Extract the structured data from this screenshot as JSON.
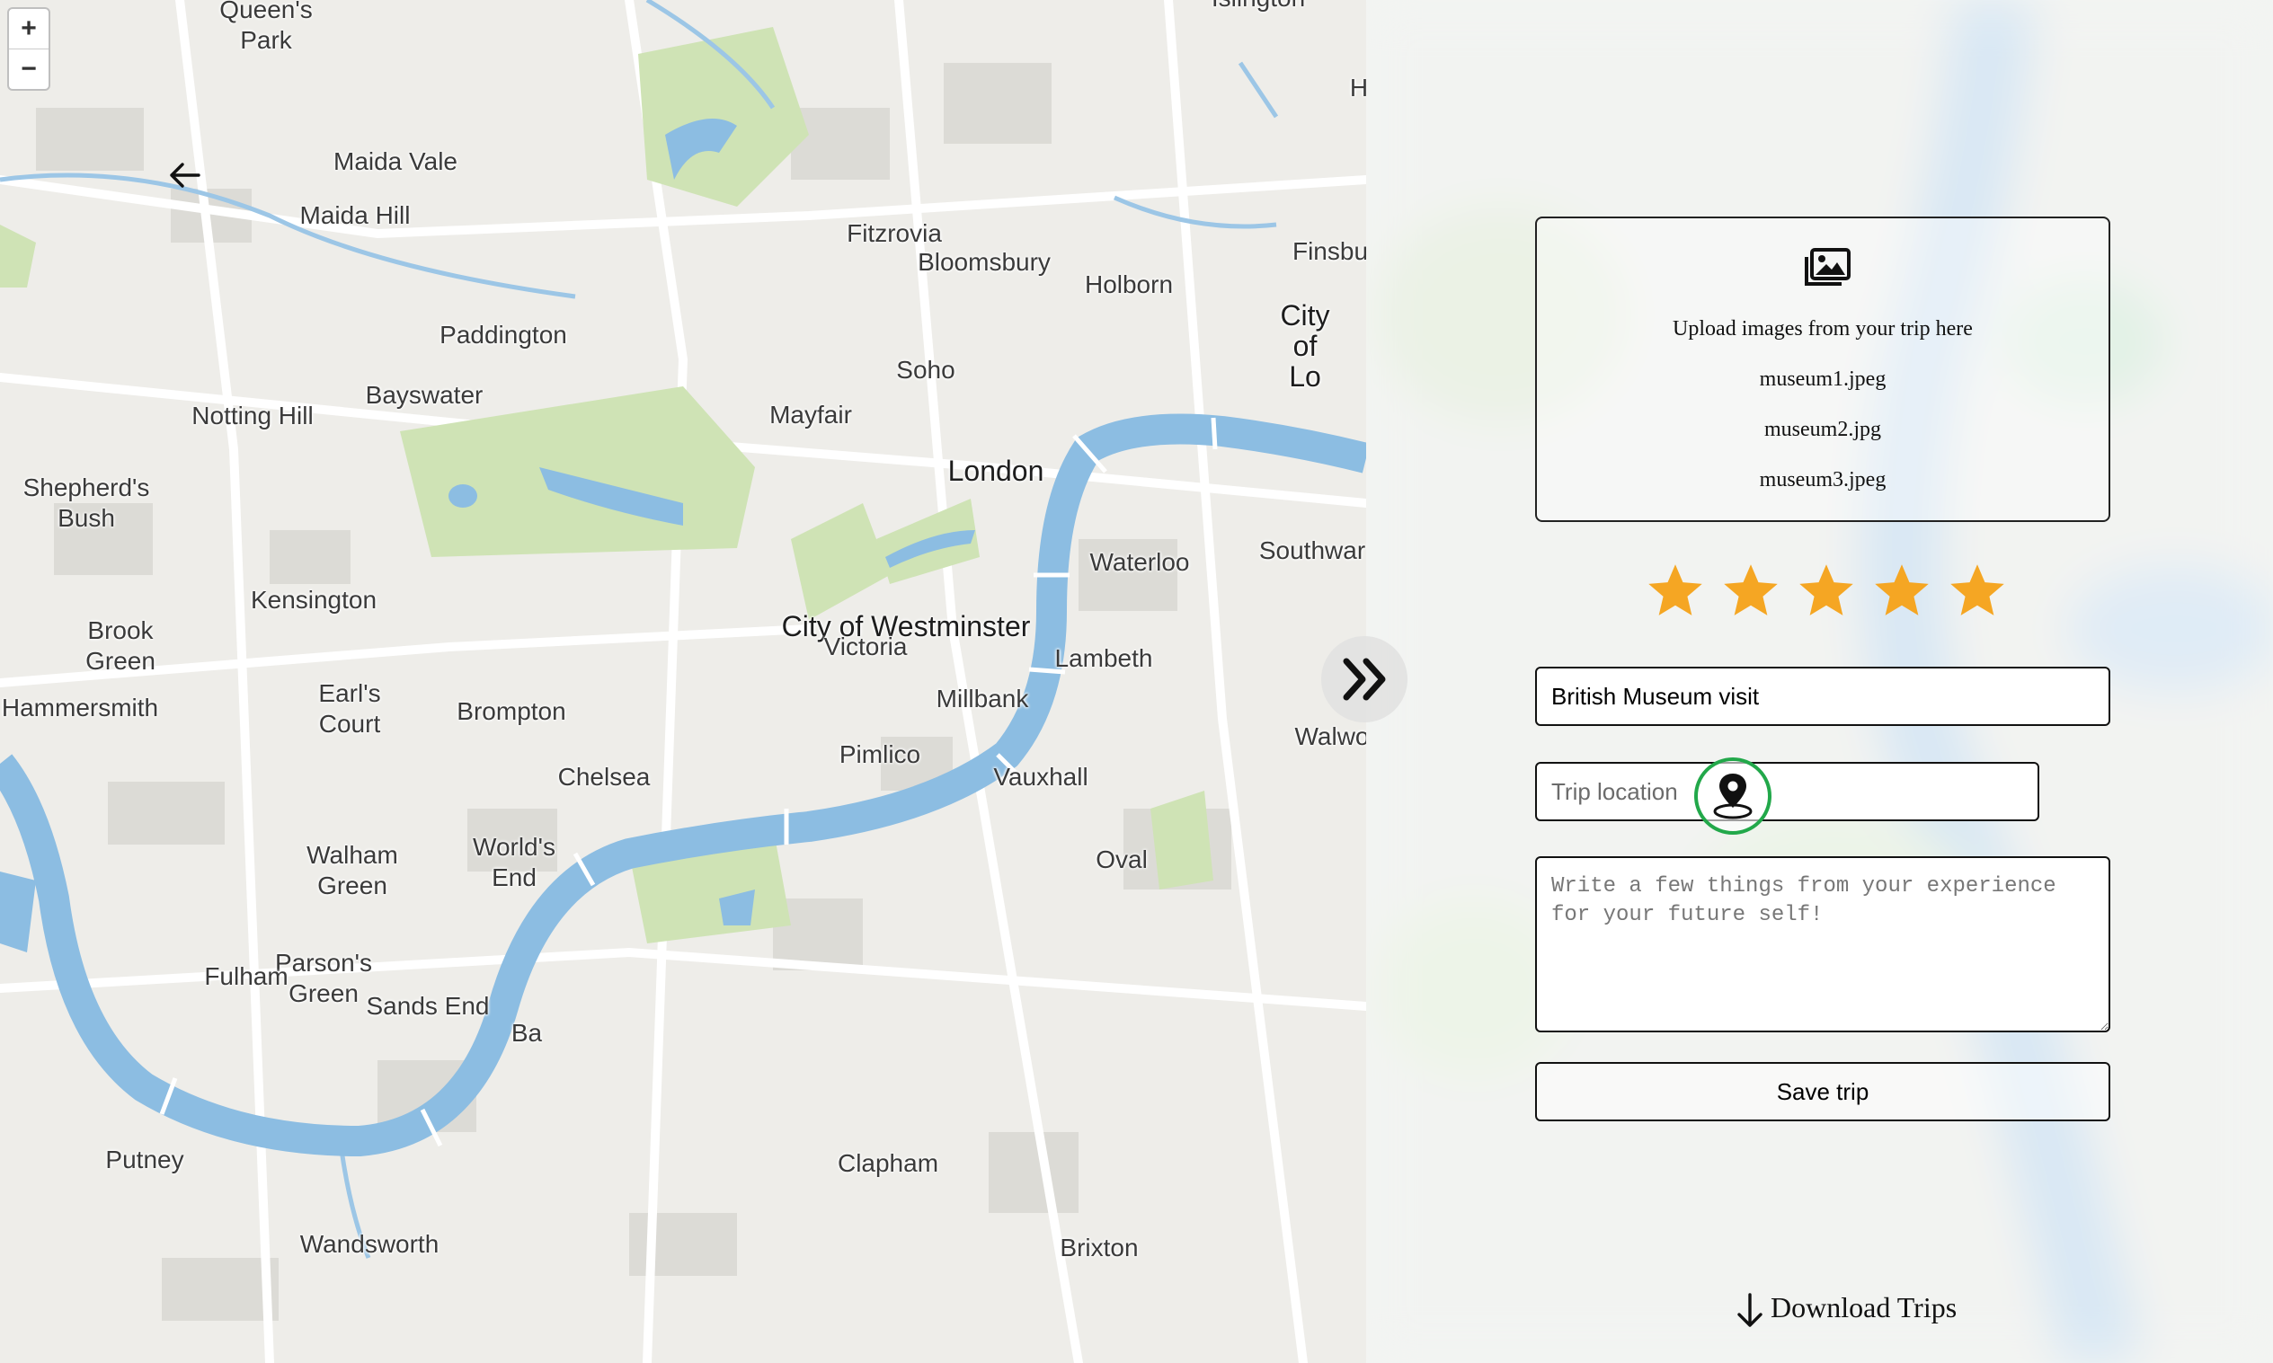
{
  "map": {
    "zoom_in": "+",
    "zoom_out": "−",
    "labels": [
      {
        "text": "Queen's\nPark",
        "big": false
      },
      {
        "text": "Maida Vale",
        "big": false
      },
      {
        "text": "Maida Hill",
        "big": false
      },
      {
        "text": "Fitzrovia",
        "big": false
      },
      {
        "text": "Bloomsbury",
        "big": false
      },
      {
        "text": "Holborn",
        "big": false
      },
      {
        "text": "Finsbu",
        "big": false
      },
      {
        "text": "Paddington",
        "big": false
      },
      {
        "text": "City of Lo",
        "big": true
      },
      {
        "text": "Soho",
        "big": false
      },
      {
        "text": "Bayswater",
        "big": false
      },
      {
        "text": "Notting Hill",
        "big": false
      },
      {
        "text": "Mayfair",
        "big": false
      },
      {
        "text": "London",
        "big": true
      },
      {
        "text": "Shepherd's\nBush",
        "big": false
      },
      {
        "text": "Waterloo",
        "big": false
      },
      {
        "text": "Southwar",
        "big": false
      },
      {
        "text": "Kensington",
        "big": false
      },
      {
        "text": "Brook\nGreen",
        "big": false
      },
      {
        "text": "City of Westminster",
        "big": true
      },
      {
        "text": "Victoria",
        "big": false
      },
      {
        "text": "Lambeth",
        "big": false
      },
      {
        "text": "Hammersmith",
        "big": false
      },
      {
        "text": "Earl's\nCourt",
        "big": false
      },
      {
        "text": "Brompton",
        "big": false
      },
      {
        "text": "Millbank",
        "big": false
      },
      {
        "text": "Walwo",
        "big": false
      },
      {
        "text": "Pimlico",
        "big": false
      },
      {
        "text": "Chelsea",
        "big": false
      },
      {
        "text": "Vauxhall",
        "big": false
      },
      {
        "text": "World's\nEnd",
        "big": false
      },
      {
        "text": "Walham\nGreen",
        "big": false
      },
      {
        "text": "Oval",
        "big": false
      },
      {
        "text": "Parson's\nGreen",
        "big": false
      },
      {
        "text": "Fulham",
        "big": false
      },
      {
        "text": "Sands End",
        "big": false
      },
      {
        "text": "Ba",
        "big": false
      },
      {
        "text": "Putney",
        "big": false
      },
      {
        "text": "Clapham",
        "big": false
      },
      {
        "text": "Wandsworth",
        "big": false
      },
      {
        "text": "Brixton",
        "big": false
      },
      {
        "text": "H",
        "big": false
      },
      {
        "text": "Islington",
        "big": false
      }
    ]
  },
  "panel": {
    "back_icon": "arrow-left-icon",
    "upload": {
      "icon": "image-gallery-icon",
      "hint": "Upload images from your trip here",
      "files": [
        "museum1.jpeg",
        "museum2.jpg",
        "museum3.jpeg"
      ]
    },
    "rating": {
      "value": 5,
      "max": 5,
      "color": "#f5a623"
    },
    "title_value": "British Museum visit",
    "location_placeholder": "Trip location",
    "location_icon": "map-pin-icon",
    "location_accent": "#22a84a",
    "notes_placeholder": "Write a few things from your experience for your future self!",
    "save_label": "Save trip",
    "download_label": "Download Trips",
    "download_icon": "arrow-down-icon",
    "toggle_icon": "double-chevron-right-icon"
  }
}
